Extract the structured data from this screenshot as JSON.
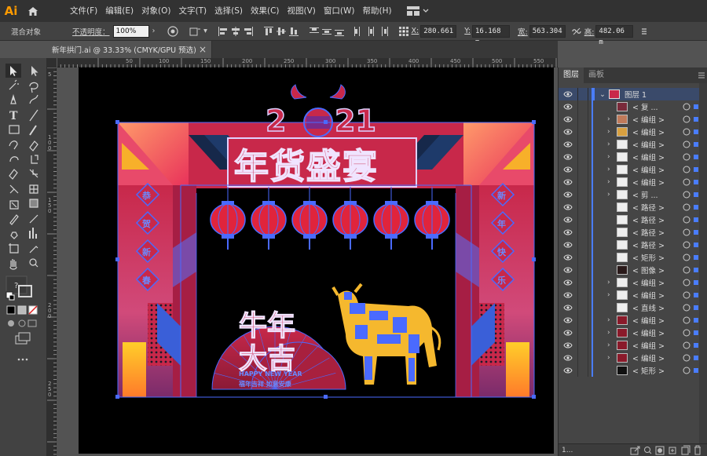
{
  "app": {
    "logo": "Ai",
    "home_icon": "home-icon"
  },
  "menu": [
    "文件(F)",
    "编辑(E)",
    "对象(O)",
    "文字(T)",
    "选择(S)",
    "效果(C)",
    "视图(V)",
    "窗口(W)",
    "帮助(H)"
  ],
  "control": {
    "selection_type": "混合对象",
    "opacity_label": "不透明度：",
    "opacity_value": "100%",
    "x_label": "X:",
    "x_value": "280.661",
    "y_label": "Y:",
    "y_value": "16.168 m",
    "w_label": "宽:",
    "w_value": "563.304",
    "h_label": "高:",
    "h_value": "482.06 m"
  },
  "document": {
    "tab_title": "新年拱门.ai @ 33.33% (CMYK/GPU 预选)",
    "close": "×"
  },
  "ruler": {
    "h_ticks": [
      "50",
      "100",
      "150",
      "200",
      "250",
      "300",
      "350",
      "400",
      "450",
      "500",
      "550"
    ],
    "v_ticks": [
      "5",
      "1 0 0",
      "1 5 0",
      "2 0 0",
      "2 5 0"
    ]
  },
  "artwork": {
    "year_left": "2",
    "year_right": "21",
    "title": "年货盛宴",
    "left_banner": [
      "恭",
      "贺",
      "新",
      "春"
    ],
    "right_banner": [
      "新",
      "年",
      "快",
      "乐"
    ],
    "slogan_top": "牛年",
    "slogan_bottom": "大吉",
    "slogan_english": "HAPPY NEW YEAR",
    "slogan_sub": "福年吉祥 如意安康"
  },
  "panel": {
    "tab_layers": "图层",
    "tab_artboards": "画板",
    "layer_name": "图层 1",
    "items": [
      {
        "name": "< 复 ...",
        "expand": false
      },
      {
        "name": "< 编组 >",
        "expand": true
      },
      {
        "name": "< 编组 >",
        "expand": true
      },
      {
        "name": "< 编组 >",
        "expand": true
      },
      {
        "name": "< 编组 >",
        "expand": true
      },
      {
        "name": "< 编组 >",
        "expand": true
      },
      {
        "name": "< 编组 >",
        "expand": true
      },
      {
        "name": "< 剪 ...",
        "expand": true
      },
      {
        "name": "< 路径 >",
        "expand": false
      },
      {
        "name": "< 路径 >",
        "expand": false
      },
      {
        "name": "< 路径 >",
        "expand": false
      },
      {
        "name": "< 路径 >",
        "expand": false
      },
      {
        "name": "< 矩形 >",
        "expand": false
      },
      {
        "name": "< 图像 >",
        "expand": false
      },
      {
        "name": "< 编组 >",
        "expand": true
      },
      {
        "name": "< 编组 >",
        "expand": true
      },
      {
        "name": "< 直线 >",
        "expand": false
      },
      {
        "name": "< 编组 >",
        "expand": true
      },
      {
        "name": "< 编组 >",
        "expand": true
      },
      {
        "name": "< 编组 >",
        "expand": true
      },
      {
        "name": "< 编组 >",
        "expand": true
      },
      {
        "name": "< 矩形 >",
        "expand": false
      }
    ],
    "footer_count": "1..."
  },
  "colors": {
    "accent": "#4a7dff",
    "arch_red": "#c8284a",
    "artboard": "#000000",
    "lantern": "#e0243c",
    "ox_yellow": "#f5b82e"
  }
}
